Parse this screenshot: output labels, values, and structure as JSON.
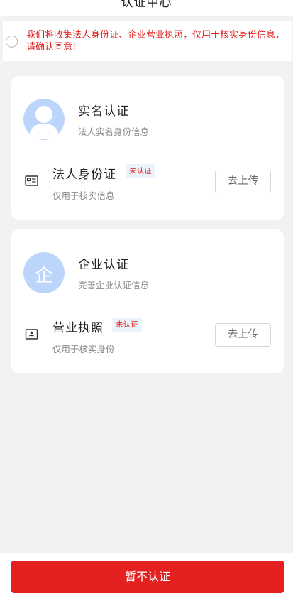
{
  "header": {
    "title": "认证中心"
  },
  "notice": {
    "text": "我们将收集法人身份证、企业营业执照，仅用于核实身份信息，请确认同意!",
    "checked": false,
    "color": "#e01b1b"
  },
  "cards": [
    {
      "title": "实名认证",
      "subtitle": "法人实名身份信息",
      "avatar_icon": "person-icon",
      "doc_icon": "id-card-icon",
      "doc_title": "法人身份证",
      "badge": "未认证",
      "doc_subtitle": "仅用于核实信息",
      "button": "去上传"
    },
    {
      "title": "企业认证",
      "subtitle": "完善企业认证信息",
      "avatar_char": "企",
      "doc_icon": "business-license-icon",
      "doc_title": "营业执照",
      "badge": "未认证",
      "doc_subtitle": "仅用于核实身份",
      "button": "去上传"
    }
  ],
  "footer": {
    "button": "暂不认证",
    "color": "#e52020"
  }
}
